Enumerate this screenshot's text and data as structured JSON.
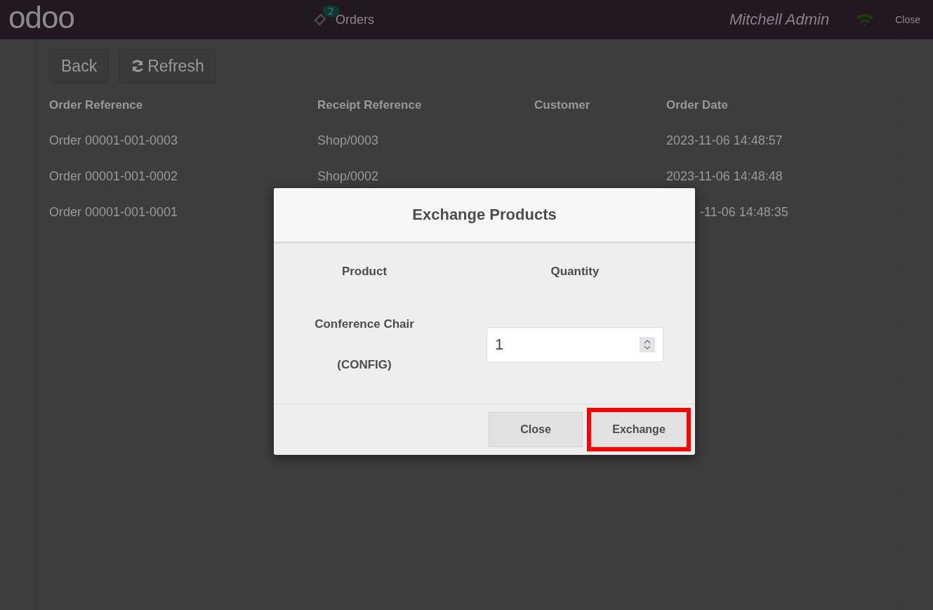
{
  "header": {
    "logo": "odoo",
    "orders_badge": "2",
    "orders_label": "Orders",
    "user": "Mitchell Admin",
    "close": "Close"
  },
  "toolbar": {
    "buttons": [
      "Back",
      "Refresh"
    ]
  },
  "table": {
    "columns": [
      "Order Reference",
      "Receipt Reference",
      "Customer",
      "Order Date"
    ],
    "rows": [
      {
        "cells": [
          "Order 00001-001-0003",
          "Shop/0003",
          "",
          "2023-11-06 14:48:57"
        ],
        "date_clipped": false
      },
      {
        "cells": [
          "Order 00001-001-0002",
          "Shop/0002",
          "",
          "2023-11-06 14:48:48"
        ],
        "date_clipped": false
      },
      {
        "cells": [
          "Order 00001-001-0001",
          "",
          "",
          "-11-06 14:48:35"
        ],
        "date_clipped": true
      }
    ]
  },
  "dialog": {
    "title": "Exchange Products",
    "columns": [
      "Product",
      "Quantity"
    ],
    "lines": [
      {
        "product": [
          "Conference Chair",
          "(CONFIG)"
        ],
        "quantity": "1"
      }
    ],
    "buttons": [
      {
        "label": "Close",
        "highlighted": false
      },
      {
        "label": "Exchange",
        "highlighted": true
      }
    ]
  }
}
